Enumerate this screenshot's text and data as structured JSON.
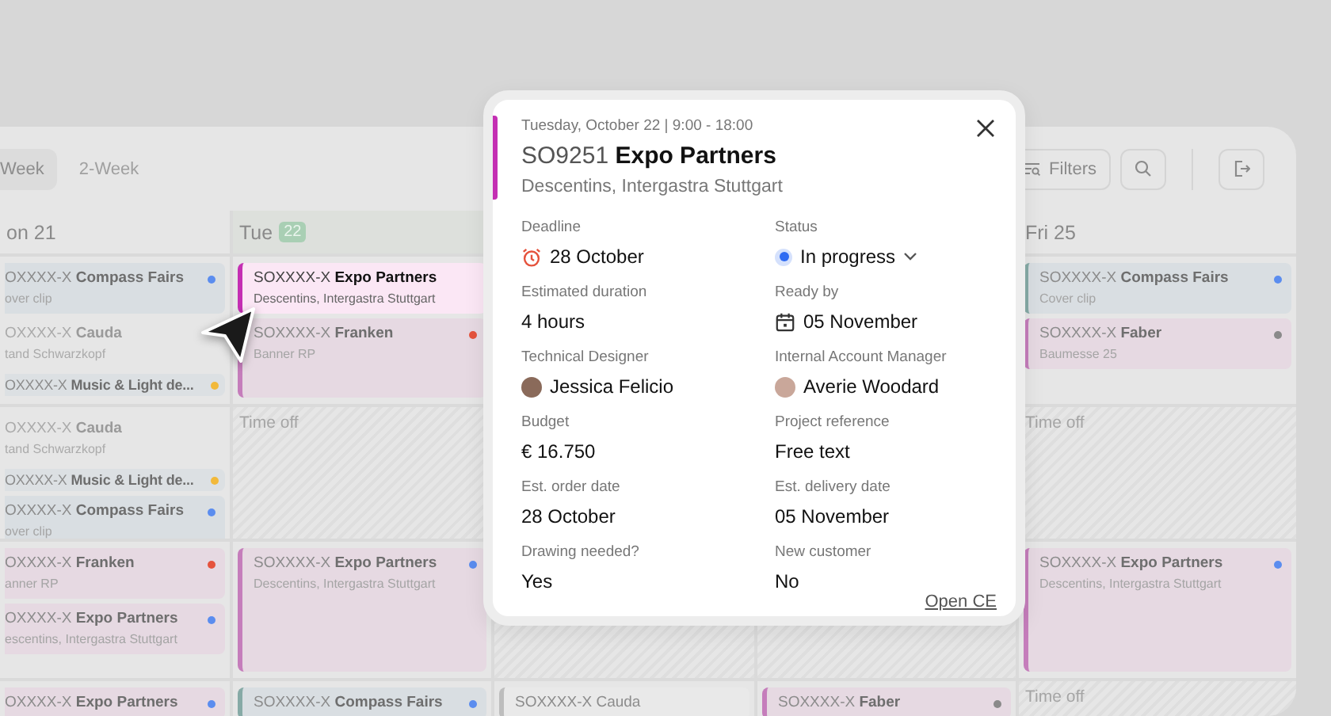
{
  "toolbar": {
    "tabs": [
      {
        "label": "Week",
        "selected": true
      },
      {
        "label": "2-Week",
        "selected": false
      }
    ],
    "filters_button": "Filters"
  },
  "days": [
    {
      "label": "on 21",
      "clipped": true,
      "slots": [
        [
          {
            "kind": "blue",
            "title": "OXXXX-X **Compass Fairs**",
            "subtitle": "over clip",
            "color": "#5b8def",
            "selected": false
          },
          {
            "kind": "plain",
            "title": "OXXXX-X **Cauda**",
            "subtitle": "tand Schwarzkopf",
            "selected": false
          },
          {
            "kind": "line",
            "title": "OXXXX-X **Music & Light de...**",
            "color": "#f2b93b",
            "selected": false
          }
        ],
        [
          {
            "kind": "plain",
            "title": "OXXXX-X **Cauda**",
            "subtitle": "tand Schwarzkopf",
            "selected": false
          },
          {
            "kind": "line",
            "title": "OXXXX-X **Music & Light de...**",
            "color": "#f2b93b",
            "selected": false
          },
          {
            "kind": "blue",
            "title": "OXXXX-X **Compass Fairs**",
            "subtitle": "over clip",
            "color": "#5b8def",
            "selected": false
          }
        ],
        [
          {
            "kind": "pink",
            "title": "OXXXX-X **Franken**",
            "subtitle": "anner RP",
            "color": "#e5533d",
            "selected": false
          },
          {
            "kind": "pink",
            "title": "OXXXX-X **Expo Partners**",
            "subtitle": "escentins, Intergastra Stuttgart",
            "color": "#5b8def",
            "selected": false
          }
        ],
        [
          {
            "kind": "pink",
            "title": "OXXXX-X **Expo Partners**",
            "color": "#5b8def",
            "selected": false
          }
        ]
      ]
    },
    {
      "label": "Tue",
      "badge": "22",
      "clipped": false,
      "slots": [
        [
          {
            "kind": "pink",
            "title": "SOXXXX-X **Expo Partners**",
            "subtitle": "Descentins, Intergastra Stuttgart",
            "selected": true
          },
          {
            "kind": "pink",
            "title": "SOXXXX-X **Franken**",
            "subtitle": "Banner RP",
            "color": "#e5533d",
            "selected": false
          }
        ],
        [
          {
            "kind": "time_off",
            "label": "Time off"
          }
        ],
        [
          {
            "kind": "pink",
            "title": "SOXXXX-X **Expo Partners**",
            "subtitle": "Descentins, Intergastra Stuttgart",
            "color": "#5b8def",
            "selected": false
          }
        ],
        [
          {
            "kind": "blue",
            "title": "SOXXXX-X **Compass Fairs**",
            "color": "#5b8def",
            "selected": false
          }
        ]
      ]
    },
    {
      "clipped": false,
      "slots": [
        [
          {
            "kind": "time_off"
          }
        ],
        [
          {
            "kind": "grey",
            "title": "SOXXXX-X Cauda",
            "selected": false
          }
        ]
      ]
    },
    {
      "clipped": false,
      "slots": [
        [
          {
            "kind": "time_off"
          }
        ],
        [
          {
            "kind": "pink",
            "title": "SOXXXX-X **Faber**",
            "color": "#8a8a8a",
            "selected": false
          }
        ]
      ]
    },
    {
      "label": "Fri 25",
      "clipped": false,
      "slots": [
        [
          {
            "kind": "blue",
            "title": "SOXXXX-X **Compass Fairs**",
            "subtitle": "Cover clip",
            "color": "#5b8def",
            "selected": false
          },
          {
            "kind": "pink",
            "title": "SOXXXX-X **Faber**",
            "subtitle": "Baumesse 25",
            "color": "#8a8a8a",
            "selected": false
          }
        ],
        [
          {
            "kind": "time_off",
            "label": "Time off"
          }
        ],
        [
          {
            "kind": "pink",
            "title": "SOXXXX-X **Expo Partners**",
            "subtitle": "Descentins, Intergastra Stuttgart",
            "color": "#5b8def",
            "selected": false
          }
        ],
        [
          {
            "kind": "time_off",
            "label": "Time off"
          }
        ]
      ]
    }
  ],
  "popup": {
    "when": "Tuesday, October 22 | 9:00 - 18:00",
    "title": "SO9251 **Expo Partners**",
    "subtitle": "Descentins, Intergastra Stuttgart",
    "fields": [
      {
        "label": "Deadline",
        "value": "28 October",
        "kind": "deadline"
      },
      {
        "label": "Status",
        "value": "In progress",
        "kind": "status",
        "color": "#2f6bf2"
      },
      {
        "label": "Estimated duration",
        "value": "4 hours",
        "kind": "text"
      },
      {
        "label": "Ready by",
        "value": "05 November",
        "kind": "date"
      },
      {
        "label": "Technical Designer",
        "value": "Jessica Felicio",
        "kind": "person"
      },
      {
        "label": "Internal Account Manager",
        "value": "Averie Woodard",
        "kind": "person"
      },
      {
        "label": "Budget",
        "value": "€ 16.750",
        "kind": "text"
      },
      {
        "label": "Project reference",
        "value": "Free text",
        "kind": "text"
      },
      {
        "label": "Est. order date",
        "value": "28 October",
        "kind": "text"
      },
      {
        "label": "Est. delivery date",
        "value": "05 November",
        "kind": "text"
      },
      {
        "label": "Drawing needed?",
        "value": "Yes",
        "kind": "text"
      },
      {
        "label": "New customer",
        "value": "No",
        "kind": "text"
      }
    ],
    "link": "Open CE"
  }
}
